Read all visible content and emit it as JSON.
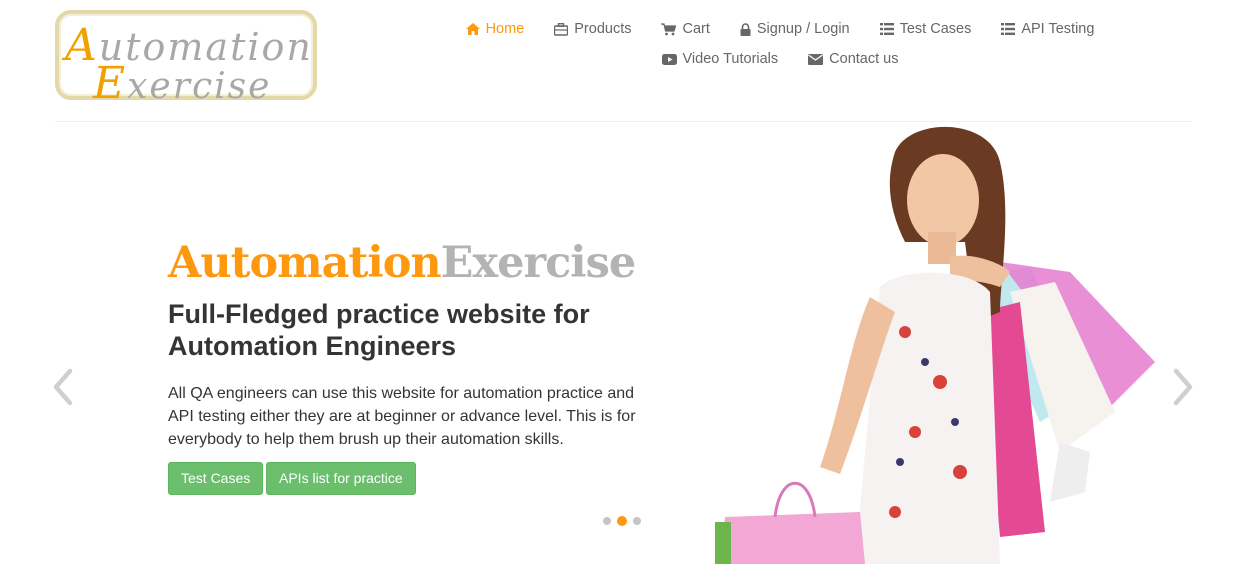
{
  "logo": {
    "line1_cap": "A",
    "line1_rest": "utomation",
    "line2_cap": "E",
    "line2_rest": "xercise"
  },
  "nav": {
    "row1": [
      {
        "label": "Home",
        "icon": "home-icon",
        "active": true
      },
      {
        "label": "Products",
        "icon": "briefcase-icon"
      },
      {
        "label": "Cart",
        "icon": "cart-icon"
      },
      {
        "label": "Signup / Login",
        "icon": "lock-icon"
      },
      {
        "label": "Test Cases",
        "icon": "list-icon"
      },
      {
        "label": "API Testing",
        "icon": "list-icon"
      }
    ],
    "row2": [
      {
        "label": "Video Tutorials",
        "icon": "youtube-icon"
      },
      {
        "label": "Contact us",
        "icon": "envelope-icon"
      }
    ]
  },
  "hero": {
    "title_part1": "Automation",
    "title_part2": "Exercise",
    "subtitle": "Full-Fledged practice website for Automation Engineers",
    "text": "All QA engineers can use this website for automation practice and API testing either they are at beginner or advance level. This is for everybody to help them brush up their automation skills.",
    "buttons": {
      "test_cases": "Test Cases",
      "apis": "APIs list for practice"
    },
    "carousel": {
      "slide_count": 3,
      "active_index": 1
    }
  },
  "colors": {
    "accent": "#fe980f",
    "button": "#5cb85c",
    "text": "#696763",
    "heading": "#363432"
  }
}
